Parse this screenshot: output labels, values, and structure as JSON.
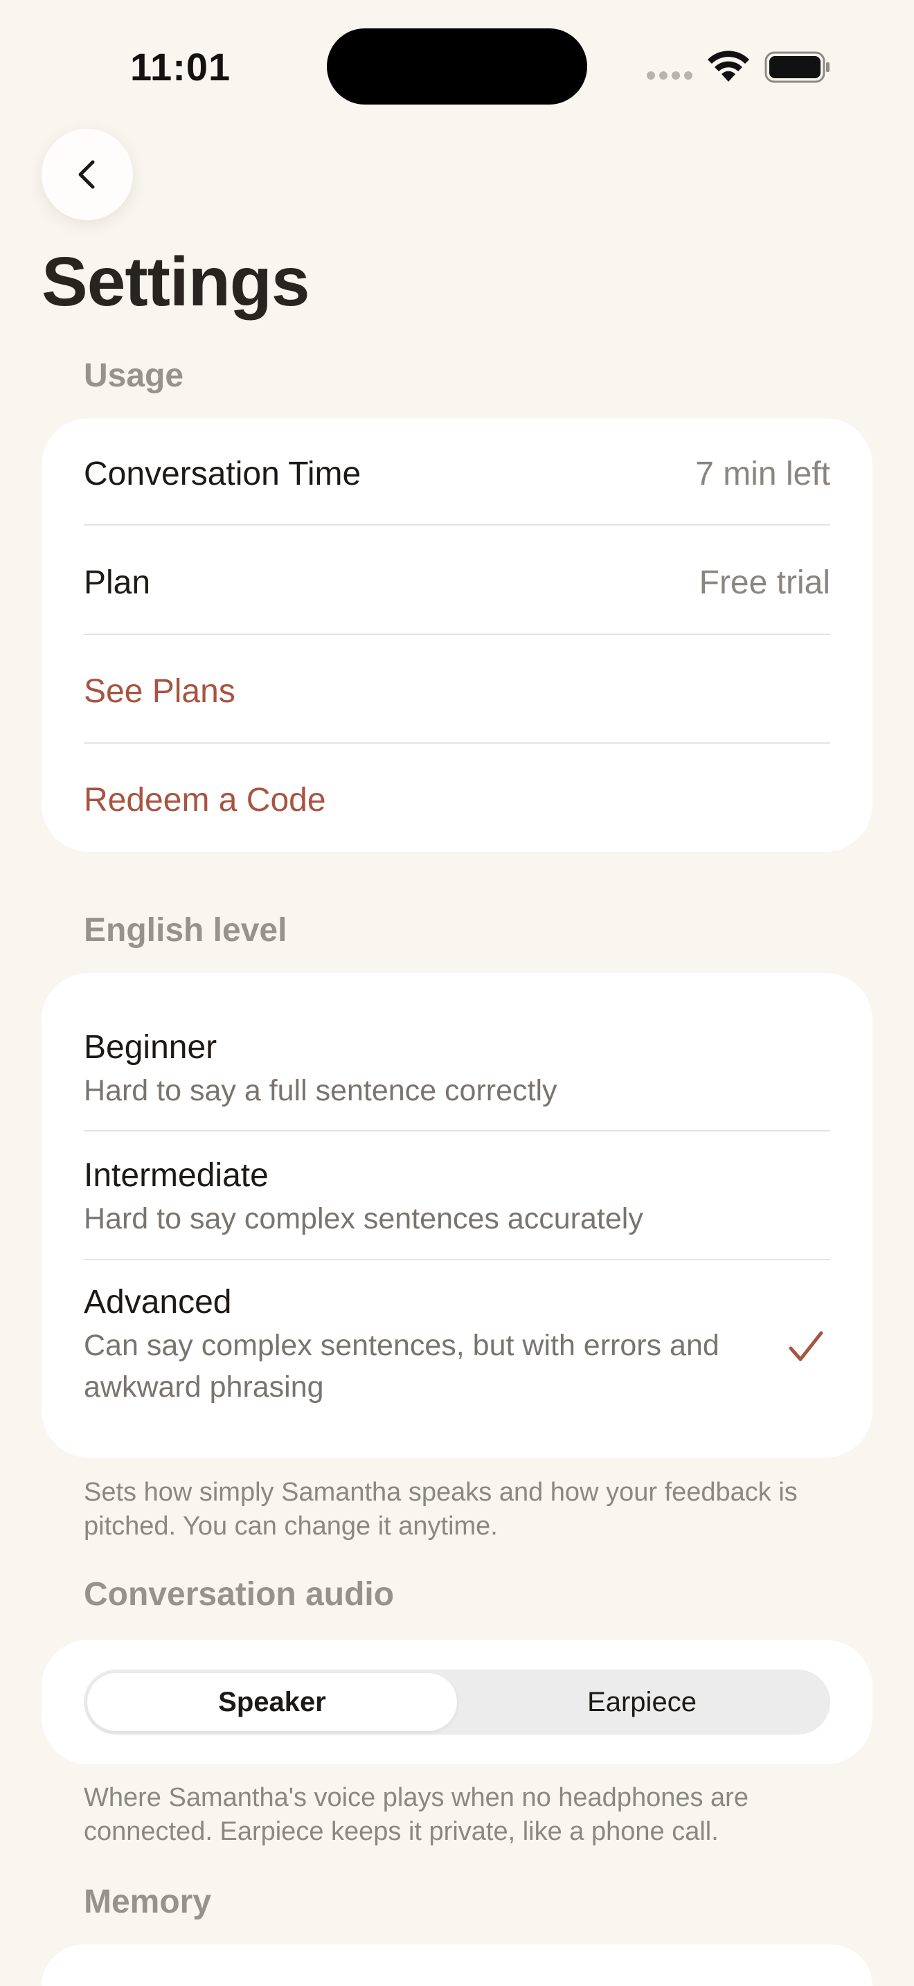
{
  "status_bar": {
    "time": "11:01"
  },
  "header": {
    "back_icon": "chevron-left-icon",
    "title": "Settings"
  },
  "usage": {
    "label": "Usage",
    "rows": [
      {
        "label": "Conversation Time",
        "value": "7 min left"
      },
      {
        "label": "Plan",
        "value": "Free trial"
      }
    ],
    "see_plans": "See Plans",
    "redeem_code": "Redeem a Code"
  },
  "english_level": {
    "label": "English level",
    "options": [
      {
        "title": "Beginner",
        "description": "Hard to say a full sentence correctly",
        "selected": false
      },
      {
        "title": "Intermediate",
        "description": "Hard to say complex sentences accurately",
        "selected": false
      },
      {
        "title": "Advanced",
        "description": "Can say complex sentences, but with errors and awkward phrasing",
        "selected": true
      }
    ],
    "footnote": "Sets how simply Samantha speaks and how your feedback is pitched. You can change it anytime."
  },
  "conversation_audio": {
    "label": "Conversation audio",
    "options": [
      "Speaker",
      "Earpiece"
    ],
    "selected": "Speaker",
    "footnote": "Where Samantha's voice plays when no headphones are connected. Earpiece keeps it private, like a phone call."
  },
  "memory": {
    "label": "Memory"
  },
  "colors": {
    "background": "#f9f5ef",
    "card": "#ffffff",
    "accent": "#a85440",
    "secondary_text": "#8a8580"
  }
}
